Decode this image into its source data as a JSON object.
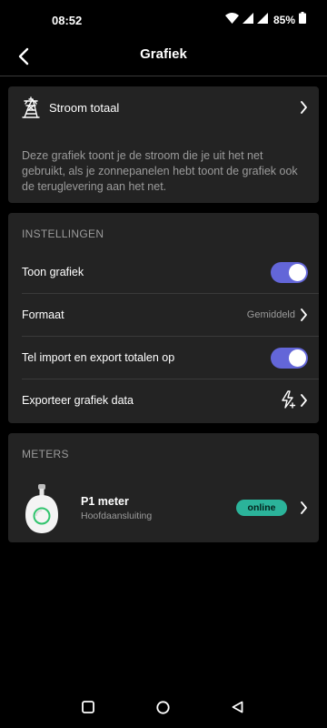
{
  "status_bar": {
    "time": "08:52",
    "battery_percent": "85%",
    "icons": [
      "wifi-icon",
      "signal-icon",
      "signal-icon",
      "battery-icon"
    ]
  },
  "header": {
    "back_icon": "chevron-left-icon",
    "title": "Grafiek"
  },
  "stroom": {
    "icon": "power-pylon-icon",
    "label": "Stroom totaal",
    "description": "Deze grafiek toont je de stroom die je uit het net gebruikt, als je zonnepanelen hebt toont de grafiek ook de teruglevering aan het net."
  },
  "instellingen": {
    "title": "INSTELLINGEN",
    "toon_grafiek": {
      "label": "Toon grafiek",
      "enabled": true
    },
    "formaat": {
      "label": "Formaat",
      "value": "Gemiddeld"
    },
    "tel_totalen": {
      "label": "Tel import en export totalen op",
      "enabled": true
    },
    "exporteer": {
      "label": "Exporteer grafiek data",
      "icon": "export-lightning-icon"
    }
  },
  "meters": {
    "title": "METERS",
    "items": [
      {
        "name": "P1 meter",
        "subtitle": "Hoofdaansluiting",
        "status": "online"
      }
    ]
  },
  "colors": {
    "background": "#000000",
    "card": "#232323",
    "toggle_on": "#6366d8",
    "online_badge": "#2bb39a",
    "muted_text": "#9b9b9b"
  },
  "nav_bar": {
    "buttons": [
      "recents-square-icon",
      "home-circle-icon",
      "back-triangle-icon"
    ]
  }
}
